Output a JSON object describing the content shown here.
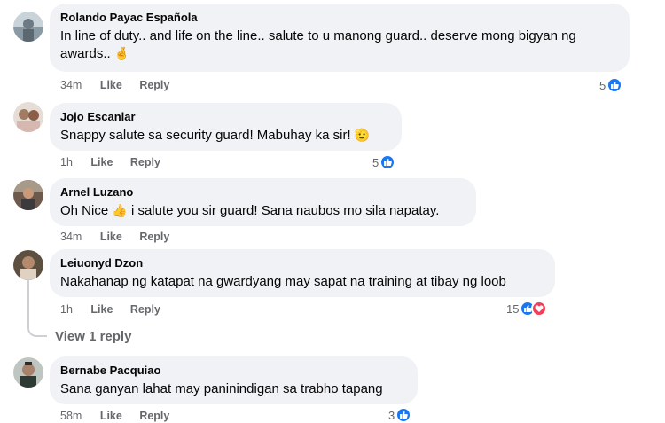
{
  "comments": [
    {
      "author": "Rolando Payac Española",
      "text": "In line of duty.. and life on the line.. salute to u manong guard.. deserve mong bigyan ng awards..",
      "emoji": "🤞",
      "time": "34m",
      "like_label": "Like",
      "reply_label": "Reply",
      "reaction_count": "5"
    },
    {
      "author": "Jojo Escanlar",
      "text": "Snappy salute sa security guard! Mabuhay ka sir!",
      "emoji": "🫡",
      "time": "1h",
      "like_label": "Like",
      "reply_label": "Reply",
      "reaction_count": "5"
    },
    {
      "author": "Arnel Luzano",
      "text_before": "Oh Nice",
      "emoji": "👍",
      "text_after": "i salute you sir guard! Sana naubos mo sila napatay.",
      "time": "34m",
      "like_label": "Like",
      "reply_label": "Reply"
    },
    {
      "author": "Leiuonyd Dzon",
      "text": "Nakahanap ng katapat na gwardyang may sapat na training at tibay ng loob",
      "time": "1h",
      "like_label": "Like",
      "reply_label": "Reply",
      "reaction_count": "15",
      "view_replies": "View 1 reply"
    },
    {
      "author": "Bernabe Pacquiao",
      "text": "Sana ganyan lahat may paninindigan sa trabho tapang",
      "time": "58m",
      "like_label": "Like",
      "reply_label": "Reply",
      "reaction_count": "3"
    }
  ],
  "icons": [
    "thumbs-up-icon",
    "heart-icon",
    "avatar"
  ],
  "colors": {
    "bubble": "#f0f2f5",
    "meta_text": "#65676b",
    "like_blue": "#1877f2",
    "love_red": "#f33e58"
  }
}
